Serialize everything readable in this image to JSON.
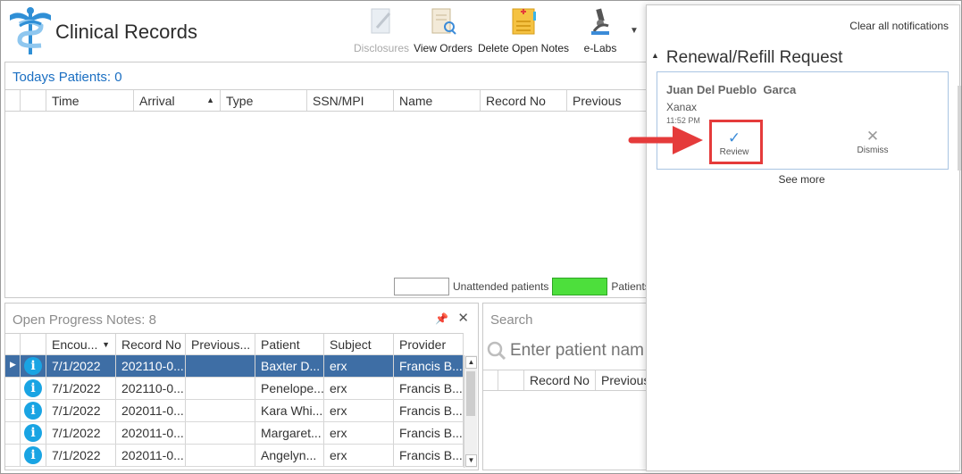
{
  "app": {
    "title": "Clinical Records"
  },
  "toolbar": {
    "items": [
      {
        "label": "Disclosures",
        "icon": "disclosures-icon",
        "enabled": false
      },
      {
        "label": "View Orders",
        "icon": "view-orders-icon",
        "enabled": true
      },
      {
        "label": "Delete Open Notes",
        "icon": "delete-notes-icon",
        "enabled": true
      },
      {
        "label": "e-Labs",
        "icon": "microscope-icon",
        "enabled": true
      }
    ],
    "more": "▼"
  },
  "todays_patients": {
    "title": "Todays Patients:  0",
    "columns": [
      "",
      "",
      "Time",
      "Arrival",
      "Type",
      "SSN/MPI",
      "Name",
      "Record No",
      "Previous"
    ],
    "rows": [],
    "legend": {
      "unattended": "Unattended patients",
      "patients_w": "Patients w"
    }
  },
  "open_notes": {
    "title": "Open Progress Notes:  8",
    "columns": [
      "",
      "",
      "Encou...",
      "Record No",
      "Previous...",
      "Patient",
      "Subject",
      "Provider"
    ],
    "rows": [
      {
        "date": "7/1/2022",
        "record": "202110-0...",
        "previous": "",
        "patient": "Baxter D...",
        "subject": "erx",
        "provider": "Francis B...",
        "selected": true
      },
      {
        "date": "7/1/2022",
        "record": "202110-0...",
        "previous": "",
        "patient": "Penelope...",
        "subject": "erx",
        "provider": "Francis B...",
        "selected": false
      },
      {
        "date": "7/1/2022",
        "record": "202011-0...",
        "previous": "",
        "patient": "Kara Whi...",
        "subject": "erx",
        "provider": "Francis B...",
        "selected": false
      },
      {
        "date": "7/1/2022",
        "record": "202011-0...",
        "previous": "",
        "patient": "Margaret...",
        "subject": "erx",
        "provider": "Francis B...",
        "selected": false
      },
      {
        "date": "7/1/2022",
        "record": "202011-0...",
        "previous": "",
        "patient": "Angelyn...",
        "subject": "erx",
        "provider": "Francis B...",
        "selected": false
      }
    ]
  },
  "search": {
    "title": "Search",
    "placeholder": "Enter patient nam",
    "columns": [
      "",
      "",
      "Record No",
      "Previous..."
    ]
  },
  "notifications": {
    "clear_all": "Clear all notifications",
    "group_title": "Renewal/Refill Request",
    "card": {
      "patient": "Juan Del Pueblo  Garca",
      "drug": "Xanax",
      "time": "11:52 PM",
      "review_label": "Review",
      "dismiss_label": "Dismiss"
    },
    "see_more": "See more"
  },
  "colors": {
    "accent_blue": "#1b6fc2",
    "selected_row": "#3e6ea5",
    "legend_green": "#4ddf3c",
    "highlight_red": "#e53b3b",
    "info_badge": "#19a4e3"
  }
}
